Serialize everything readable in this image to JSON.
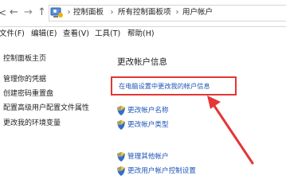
{
  "nav": {
    "left_fragment": "<",
    "back_glyph": "←",
    "forward_glyph": "→",
    "up_glyph": "↑",
    "breadcrumbs": [
      "控制面板",
      "所有控制面板项",
      "用户帐户"
    ],
    "separator": "›"
  },
  "menu": {
    "items": [
      "文件(F)",
      "编辑(E)",
      "查看(V)",
      "工具(T)",
      "帮助(H)"
    ]
  },
  "left_pane": {
    "home": "控制面板主页",
    "links": [
      "管理你的凭据",
      "创建密码重置盘",
      "配置高级用户配置文件属性",
      "更改我的环境变量"
    ]
  },
  "main": {
    "title": "更改帐户信息",
    "highlight_link": "在电脑设置中更改我的帐户信息",
    "tasks": [
      "更改帐户名称",
      "更改帐户类型",
      "管理其他帐户",
      "更改用户帐户控制设置"
    ]
  },
  "colors": {
    "accent_link": "#1f56b7",
    "annotation_red": "#e43636"
  }
}
